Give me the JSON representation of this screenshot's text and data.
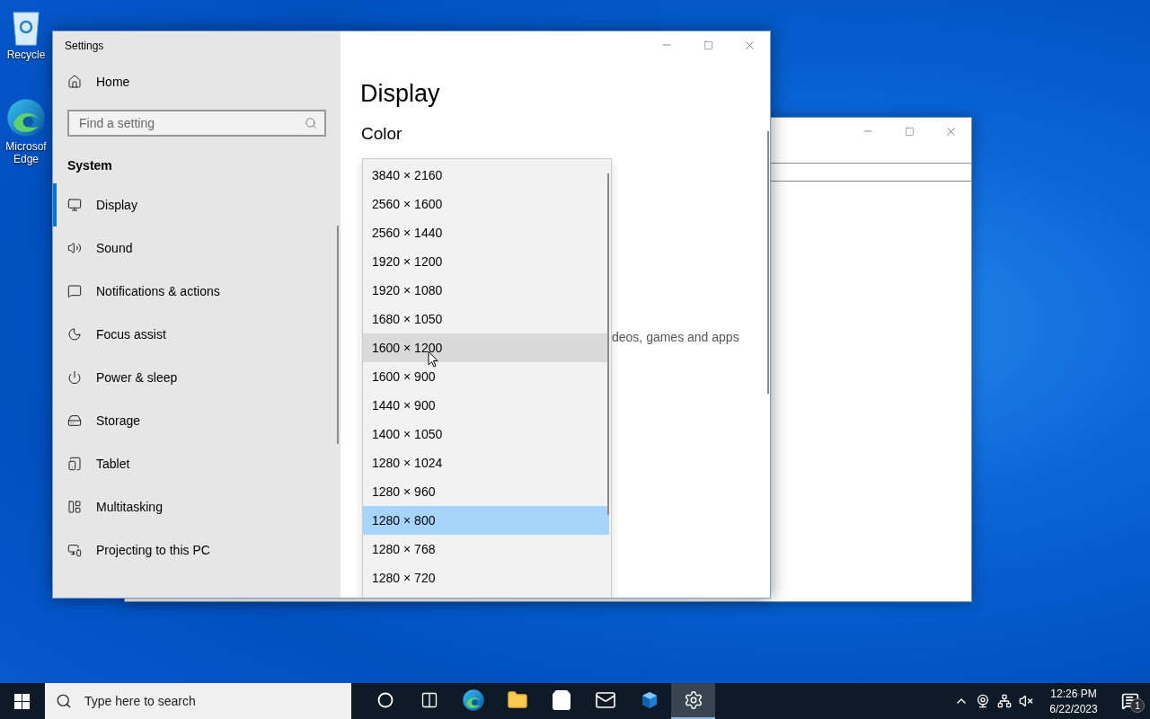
{
  "desktop_icons": [
    {
      "kind": "recycle-bin",
      "label": "Recycle"
    },
    {
      "kind": "edge",
      "label": "Microsof Edge"
    }
  ],
  "settings_window": {
    "title": "Settings",
    "home": "Home",
    "search": {
      "placeholder": "Find a setting"
    },
    "section": "System",
    "nav_items": [
      {
        "kind": "display",
        "label": "Display",
        "selected": true
      },
      {
        "kind": "sound",
        "label": "Sound",
        "selected": false
      },
      {
        "kind": "notifications",
        "label": "Notifications & actions",
        "selected": false
      },
      {
        "kind": "focus",
        "label": "Focus assist",
        "selected": false
      },
      {
        "kind": "power",
        "label": "Power & sleep",
        "selected": false
      },
      {
        "kind": "storage",
        "label": "Storage",
        "selected": false
      },
      {
        "kind": "tablet",
        "label": "Tablet",
        "selected": false
      },
      {
        "kind": "multitasking",
        "label": "Multitasking",
        "selected": false
      },
      {
        "kind": "projecting",
        "label": "Projecting to this PC",
        "selected": false
      }
    ],
    "page_title": "Display",
    "heading": "Color",
    "partial_text": "deos, games and apps",
    "resolution_options": [
      {
        "label": "3840 × 2160",
        "selected": false,
        "hovered": false
      },
      {
        "label": "2560 × 1600",
        "selected": false,
        "hovered": false
      },
      {
        "label": "2560 × 1440",
        "selected": false,
        "hovered": false
      },
      {
        "label": "1920 × 1200",
        "selected": false,
        "hovered": false
      },
      {
        "label": "1920 × 1080",
        "selected": false,
        "hovered": false
      },
      {
        "label": "1680 × 1050",
        "selected": false,
        "hovered": false
      },
      {
        "label": "1600 × 1200",
        "selected": false,
        "hovered": true
      },
      {
        "label": "1600 × 900",
        "selected": false,
        "hovered": false
      },
      {
        "label": "1440 × 900",
        "selected": false,
        "hovered": false
      },
      {
        "label": "1400 × 1050",
        "selected": false,
        "hovered": false
      },
      {
        "label": "1280 × 1024",
        "selected": false,
        "hovered": false
      },
      {
        "label": "1280 × 960",
        "selected": false,
        "hovered": false
      },
      {
        "label": "1280 × 800",
        "selected": true,
        "hovered": false
      },
      {
        "label": "1280 × 768",
        "selected": false,
        "hovered": false
      },
      {
        "label": "1280 × 720",
        "selected": false,
        "hovered": false
      }
    ]
  },
  "taskbar": {
    "search": {
      "placeholder": "Type here to search"
    },
    "apps": [
      {
        "kind": "cortana",
        "active": false
      },
      {
        "kind": "task-view",
        "active": false
      },
      {
        "kind": "edge",
        "active": false
      },
      {
        "kind": "explorer",
        "active": false
      },
      {
        "kind": "store",
        "active": false
      },
      {
        "kind": "mail",
        "active": false
      },
      {
        "kind": "cube",
        "active": false
      },
      {
        "kind": "settings",
        "active": true
      }
    ],
    "time": "12:26 PM",
    "date": "6/22/2023",
    "notification_count": "1"
  }
}
